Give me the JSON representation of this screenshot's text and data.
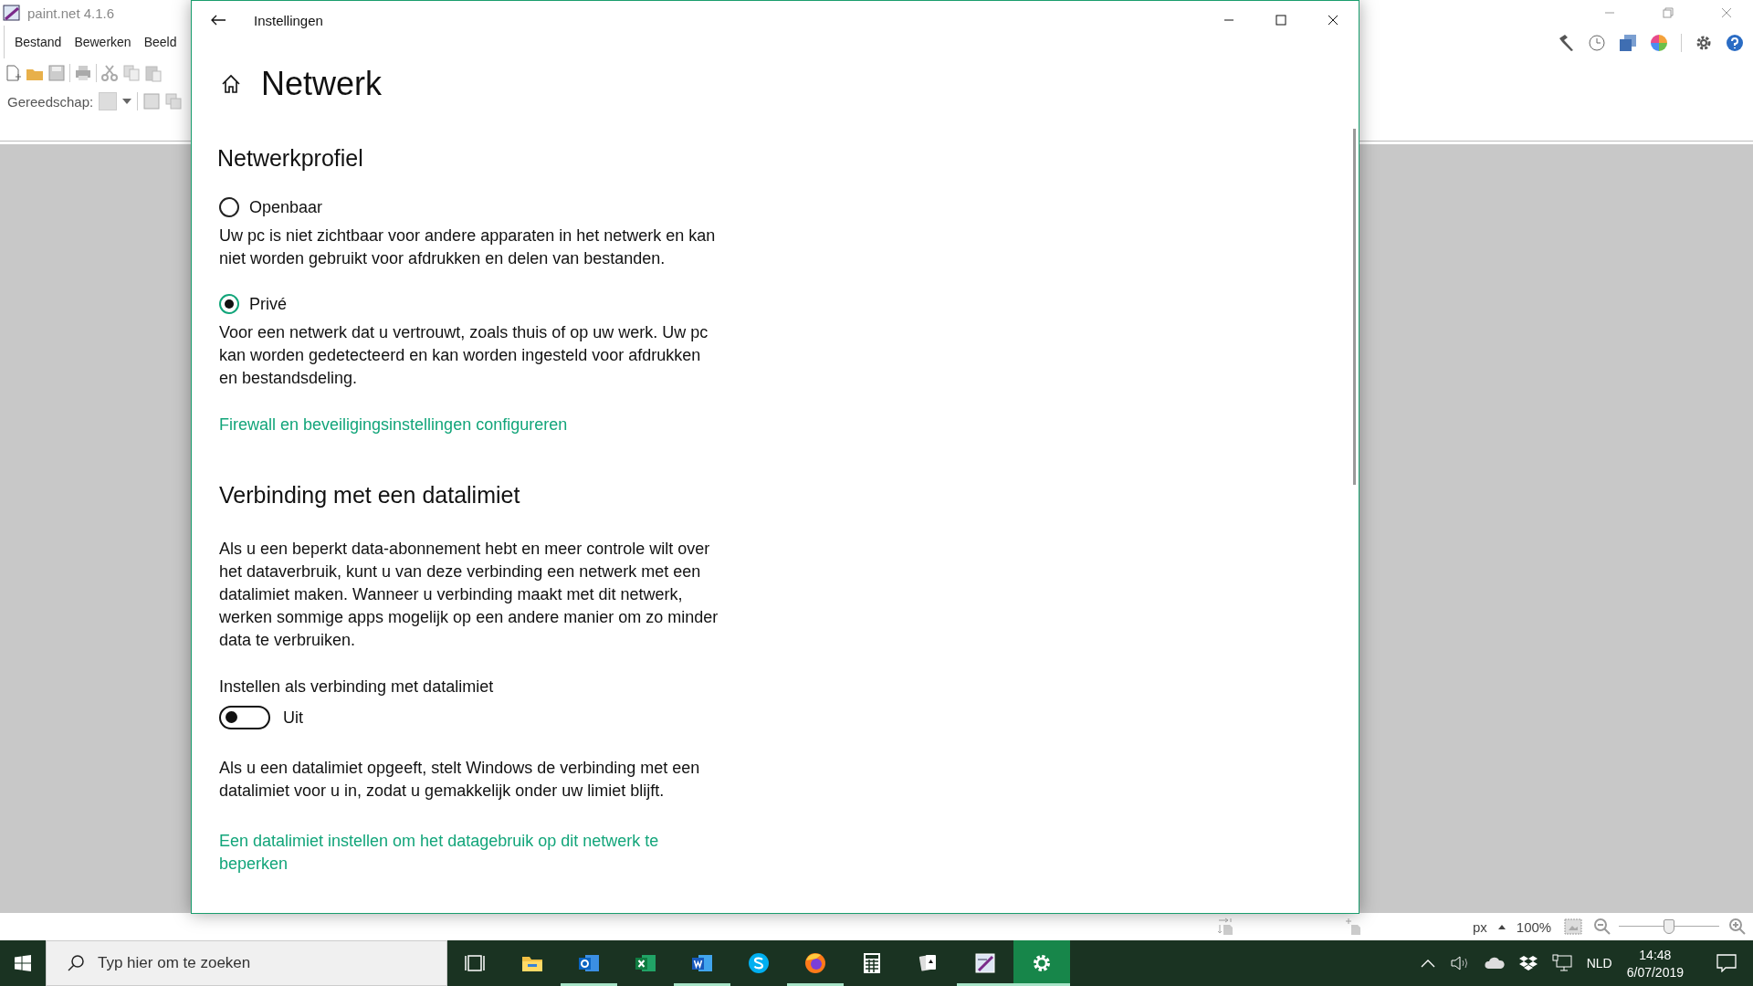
{
  "paint_app": {
    "title": "paint.net 4.1.6",
    "menu": [
      "Bestand",
      "Bewerken",
      "Beeld"
    ],
    "tool_label": "Gereedschap:",
    "status_bar": {
      "unit": "px",
      "zoom": "100%",
      "zoom_slider": {
        "level": 0.5
      }
    }
  },
  "window": {
    "title": "Instellingen",
    "heading": "Netwerk"
  },
  "network_profile": {
    "title": "Netwerkprofiel",
    "options": [
      {
        "label": "Openbaar",
        "description": "Uw pc is niet zichtbaar voor andere apparaten in het netwerk en kan niet worden gebruikt voor afdrukken en delen van bestanden.",
        "selected": false
      },
      {
        "label": "Privé",
        "description": "Voor een netwerk dat u vertrouwt, zoals thuis of op uw werk. Uw pc kan worden gedetecteerd en kan worden ingesteld voor afdrukken en bestandsdeling.",
        "selected": true
      }
    ],
    "link": "Firewall en beveiligingsinstellingen configureren"
  },
  "metered_connection": {
    "title": "Verbinding met een datalimiet",
    "description": "Als u een beperkt data-abonnement hebt en meer controle wilt over het dataverbruik, kunt u van deze verbinding een netwerk met een datalimiet maken. Wanneer u verbinding maakt met dit netwerk, werken sommige apps mogelijk op een andere manier om zo minder data te verbruiken.",
    "setting_label": "Instellen als verbinding met datalimiet",
    "toggle": {
      "on": false,
      "label": "Uit"
    },
    "note": "Als u een datalimiet opgeeft, stelt Windows de verbinding met een datalimiet voor u in, zodat u gemakkelijk onder uw limiet blijft.",
    "link": "Een datalimiet instellen om het datagebruik op dit netwerk te beperken"
  },
  "taskbar": {
    "search_placeholder": "Typ hier om te zoeken",
    "apps": [
      {
        "kind": "taskview",
        "running": false,
        "active": false
      },
      {
        "kind": "explorer",
        "running": false,
        "active": false
      },
      {
        "kind": "outlook",
        "running": true,
        "active": false
      },
      {
        "kind": "excel",
        "running": false,
        "active": false
      },
      {
        "kind": "word",
        "running": true,
        "active": false
      },
      {
        "kind": "skype",
        "running": false,
        "active": false
      },
      {
        "kind": "firefox",
        "running": true,
        "active": false
      },
      {
        "kind": "calculator",
        "running": false,
        "active": false
      },
      {
        "kind": "solitaire",
        "running": false,
        "active": false
      },
      {
        "kind": "paint",
        "running": true,
        "active": false
      },
      {
        "kind": "settings",
        "running": true,
        "active": true
      }
    ],
    "language": "NLD",
    "time": "14:48",
    "date": "6/07/2019"
  }
}
